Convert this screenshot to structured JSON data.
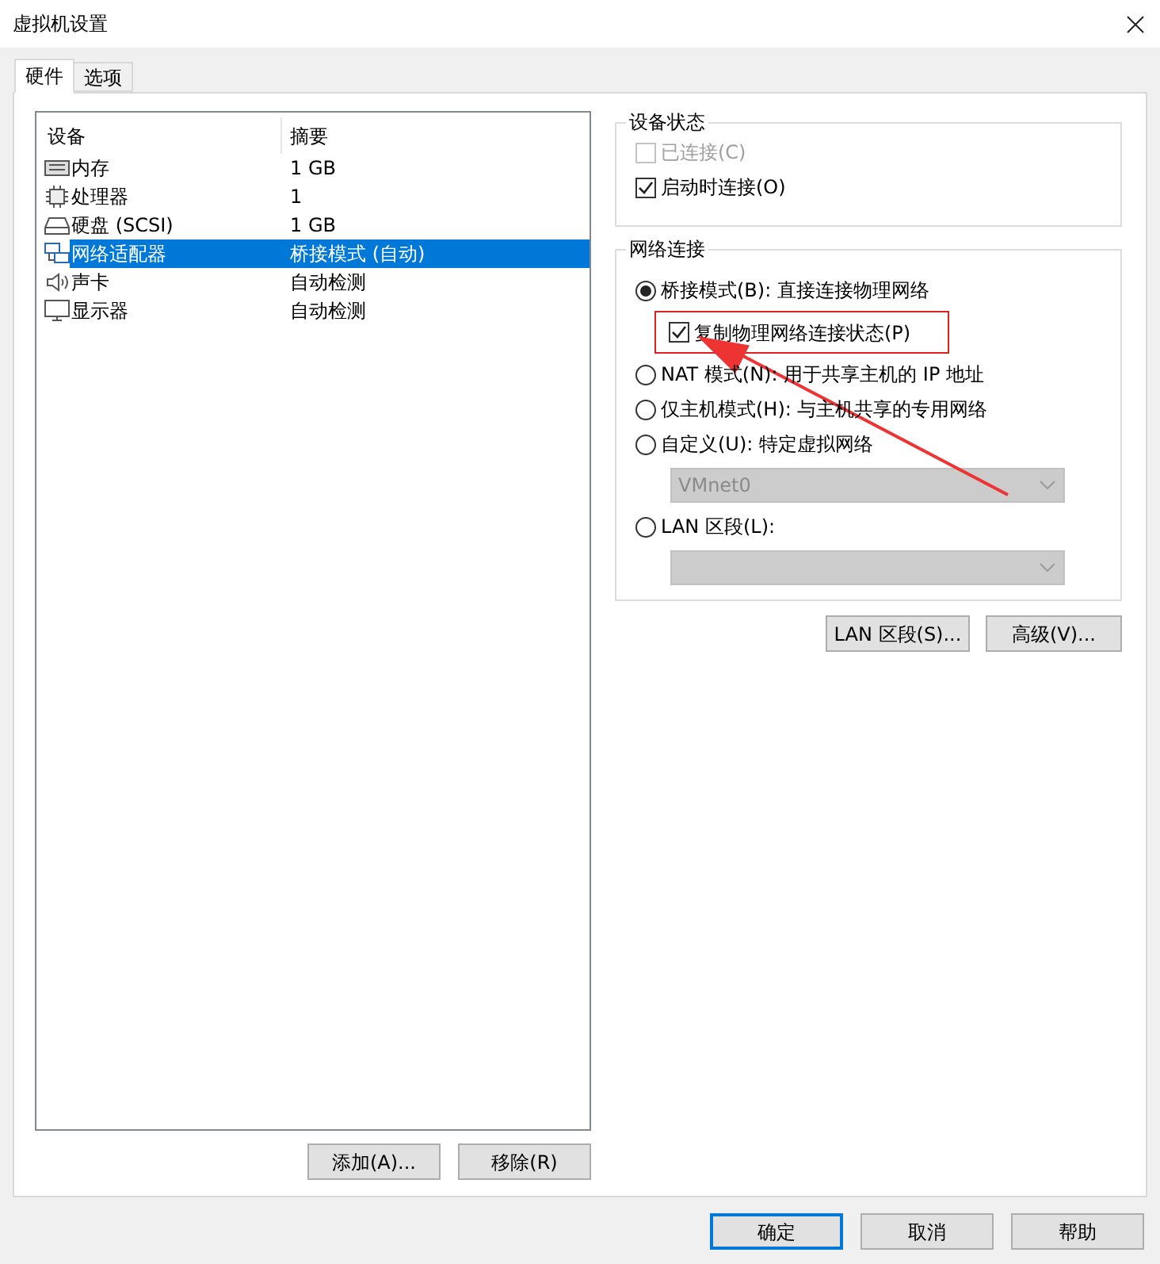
{
  "window": {
    "title": "虚拟机设置"
  },
  "tabs": [
    {
      "label": "硬件",
      "selected": true
    },
    {
      "label": "选项",
      "selected": false
    }
  ],
  "device_list": {
    "columns": [
      "设备",
      "摘要"
    ],
    "rows": [
      {
        "kind": "memory",
        "device": "内存",
        "summary": "1 GB",
        "selected": false
      },
      {
        "kind": "processor",
        "device": "处理器",
        "summary": "1",
        "selected": false
      },
      {
        "kind": "disk",
        "device": "硬盘 (SCSI)",
        "summary": "1 GB",
        "selected": false
      },
      {
        "kind": "network",
        "device": "网络适配器",
        "summary": "桥接模式 (自动)",
        "selected": true
      },
      {
        "kind": "sound",
        "device": "声卡",
        "summary": "自动检测",
        "selected": false
      },
      {
        "kind": "display",
        "device": "显示器",
        "summary": "自动检测",
        "selected": false
      }
    ]
  },
  "device_status": {
    "title": "设备状态",
    "options": [
      {
        "label": "已连接(C)",
        "checked": false,
        "disabled": true
      },
      {
        "label": "启动时连接(O)",
        "checked": true,
        "disabled": false
      }
    ]
  },
  "network_connection": {
    "title": "网络连接",
    "options": [
      {
        "kind": "radio",
        "label": "桥接模式(B): 直接连接物理网络",
        "selected": true
      },
      {
        "kind": "checkbox",
        "label": "复制物理网络连接状态(P)",
        "checked": true,
        "highlighted": true
      },
      {
        "kind": "radio",
        "label": "NAT 模式(N): 用于共享主机的 IP 地址",
        "selected": false
      },
      {
        "kind": "radio",
        "label": "仅主机模式(H): 与主机共享的专用网络",
        "selected": false
      },
      {
        "kind": "radio",
        "label": "自定义(U): 特定虚拟网络",
        "selected": false
      },
      {
        "kind": "dropdown",
        "value": "VMnet0",
        "disabled": true
      },
      {
        "kind": "radio",
        "label": "LAN 区段(L):",
        "selected": false
      },
      {
        "kind": "dropdown",
        "disabled": true
      }
    ]
  },
  "network_buttons": [
    "LAN 区段(S)...",
    "高级(V)..."
  ],
  "list_buttons": [
    "添加(A)...",
    "移除(R)"
  ],
  "dialog_buttons": [
    {
      "label": "确定",
      "default": true
    },
    {
      "label": "取消",
      "default": false
    },
    {
      "label": "帮助",
      "default": false
    }
  ]
}
